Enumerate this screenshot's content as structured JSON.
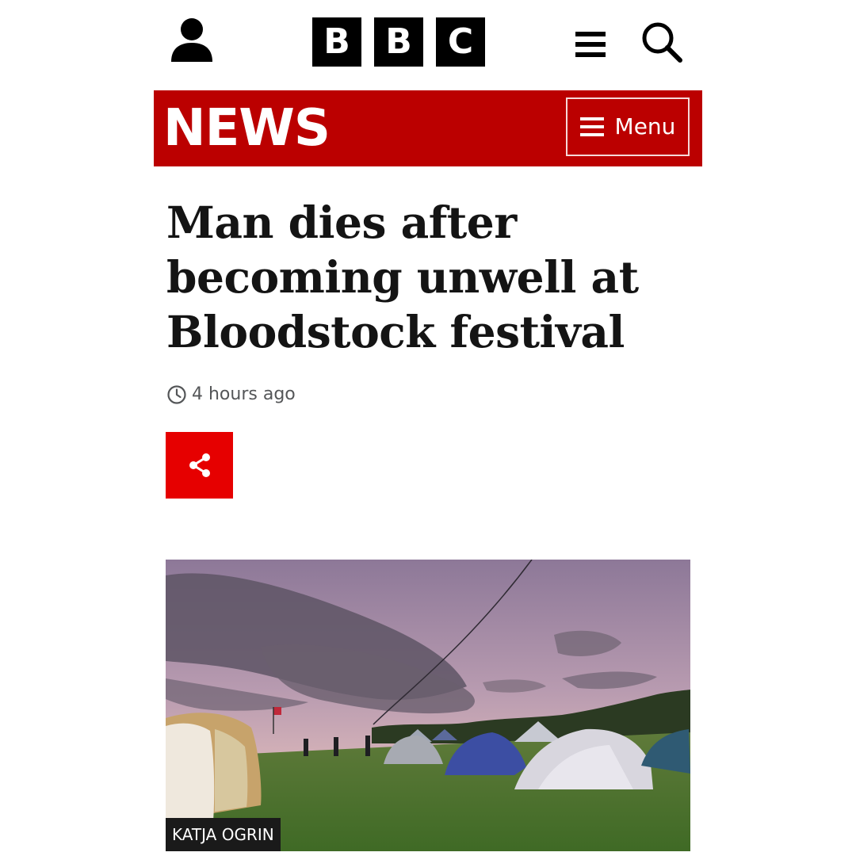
{
  "header": {
    "logo_letters": [
      "B",
      "B",
      "C"
    ],
    "account_icon": "account-icon",
    "menu_icon": "hamburger-icon",
    "search_icon": "search-icon"
  },
  "banner": {
    "title": "NEWS",
    "menu_label": "Menu",
    "menu_icon": "hamburger-icon",
    "background_color": "#bb0000"
  },
  "article": {
    "headline": "Man dies after becoming unwell at Bloodstock festival",
    "timestamp": "4 hours ago",
    "timestamp_icon": "clock-icon",
    "share_icon": "share-icon",
    "share_color": "#e60000"
  },
  "hero": {
    "credit": "KATJA OGRIN",
    "image_subject": "festival-campsite-tents-at-dusk"
  }
}
